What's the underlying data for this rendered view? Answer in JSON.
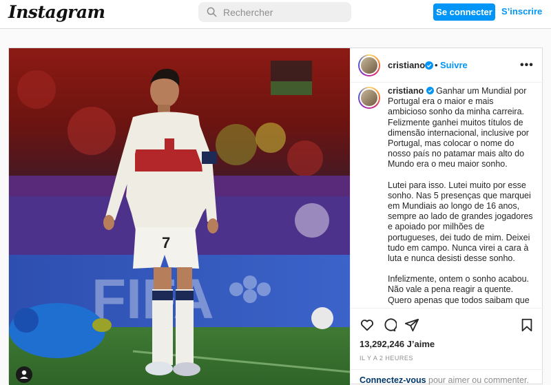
{
  "header": {
    "logo_text": "Instagram",
    "search_placeholder": "Rechercher",
    "login_button": "Se connecter",
    "signup_link": "S’inscrire",
    "accent_color": "#0095f6"
  },
  "post": {
    "username": "cristiano",
    "follow_label": "Suivre",
    "more_label": "•••",
    "caption_paragraphs": [
      "Ganhar um Mundial por Portugal era o maior e mais ambicioso sonho da minha carreira. Felizmente ganhei muitos títulos de dimensão internacional, inclusive por Portugal, mas colocar o nome do nosso país no patamar mais alto do Mundo era o meu maior sonho.",
      "Lutei para isso. Lutei muito por esse sonho. Nas 5 presenças que marquei em Mundiais ao longo de 16 anos, sempre ao lado de grandes jogadores e apoiado por milhões de portugueses, dei tudo de mim. Deixei tudo em campo. Nunca virei a cara à luta e nunca desisti desse sonho.",
      "Infelizmente, ontem o sonho acabou. Não vale a pena reagir a quente. Quero apenas que todos saibam que"
    ],
    "likes": "13,292,246 J’aime",
    "timestamp": "IL Y A 2 HEURES",
    "login_prompt_link": "Connectez-vous",
    "login_prompt_rest": " pour aimer ou commenter.",
    "photo_labels": {
      "jersey_number": "7",
      "board_text": "FIFA"
    },
    "icons": [
      "heart-icon",
      "comment-icon",
      "share-icon",
      "bookmark-icon",
      "verified-icon",
      "search-icon",
      "user-tag-icon"
    ]
  }
}
